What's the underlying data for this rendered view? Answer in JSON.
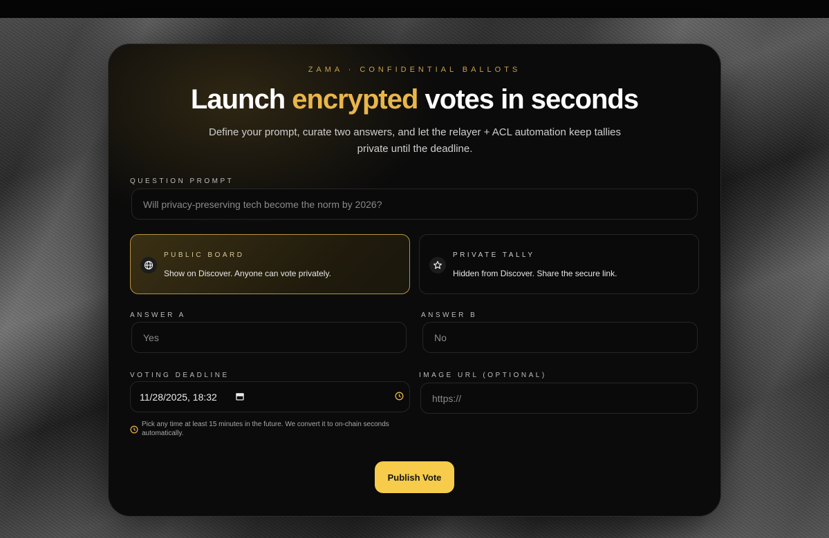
{
  "header": {
    "eyebrow": "ZAMA · CONFIDENTIAL BALLOTS",
    "title_part1": "Launch ",
    "title_accent": "encrypted",
    "title_part2": " votes in seconds",
    "subtitle": "Define your prompt, curate two answers, and let the relayer + ACL automation keep tallies private until the deadline."
  },
  "question": {
    "label": "QUESTION PROMPT",
    "placeholder": "Will privacy-preserving tech become the norm by 2026?"
  },
  "visibility": {
    "public": {
      "title": "PUBLIC BOARD",
      "description": "Show on Discover. Anyone can vote privately.",
      "icon": "globe-icon",
      "selected": true
    },
    "private": {
      "title": "PRIVATE TALLY",
      "description": "Hidden from Discover. Share the secure link.",
      "icon": "star-icon",
      "selected": false
    }
  },
  "answers": {
    "a_label": "ANSWER A",
    "a_placeholder": "Yes",
    "b_label": "ANSWER B",
    "b_placeholder": "No"
  },
  "deadline": {
    "label": "VOTING DEADLINE",
    "value": "11/28/2025, 18:32",
    "hint": "Pick any time at least 15 minutes in the future. We convert it to on-chain seconds automatically."
  },
  "image": {
    "label": "IMAGE URL (OPTIONAL)",
    "placeholder": "https://"
  },
  "actions": {
    "publish_label": "Publish Vote"
  },
  "colors": {
    "accent": "#e9b64a",
    "button": "#f6cc4a",
    "card_bg": "#0b0b0b"
  }
}
